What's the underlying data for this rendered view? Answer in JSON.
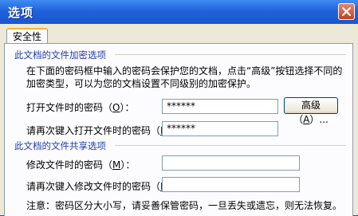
{
  "window": {
    "title": "选项"
  },
  "tabs": [
    {
      "label": "安全性"
    }
  ],
  "encrypt_section": {
    "title": "此文档的文件加密选项",
    "description_line1": "在下面的密码框中输入的密码会保护您的文档，点击“高级”按钮选择不同的",
    "description_line2": "加密类型，可以为您的文档设置不同级别的加密保护。",
    "open_password": {
      "label_prefix": "打开文件时的密码（",
      "accel": "O",
      "label_suffix": "）：",
      "value": "******"
    },
    "reenter_open_password": {
      "label_prefix": "请再次键入打开文件时的密码（",
      "accel": "P",
      "label_suffix": "）：",
      "value": "******"
    },
    "advanced_button": {
      "label_prefix": "高级（",
      "accel": "A",
      "label_suffix": "）..."
    }
  },
  "share_section": {
    "title": "此文档的文件共享选项",
    "modify_password": {
      "label_prefix": "修改文件时的密码（",
      "accel": "M",
      "label_suffix": "）：",
      "value": ""
    },
    "reenter_modify_password": {
      "label_prefix": "请再次键入修改文件时的密码（",
      "accel": "R",
      "label_suffix": "）：",
      "value": ""
    }
  },
  "note": "注意：密码区分大小写，请妥善保管密码，一旦丢失或遗忘，则无法恢复。",
  "colors": {
    "title_bar": "#1f63db",
    "section_title": "#1f3bab",
    "dialog_bg": "#ece9d8"
  },
  "icons": {
    "close": "close-icon"
  }
}
